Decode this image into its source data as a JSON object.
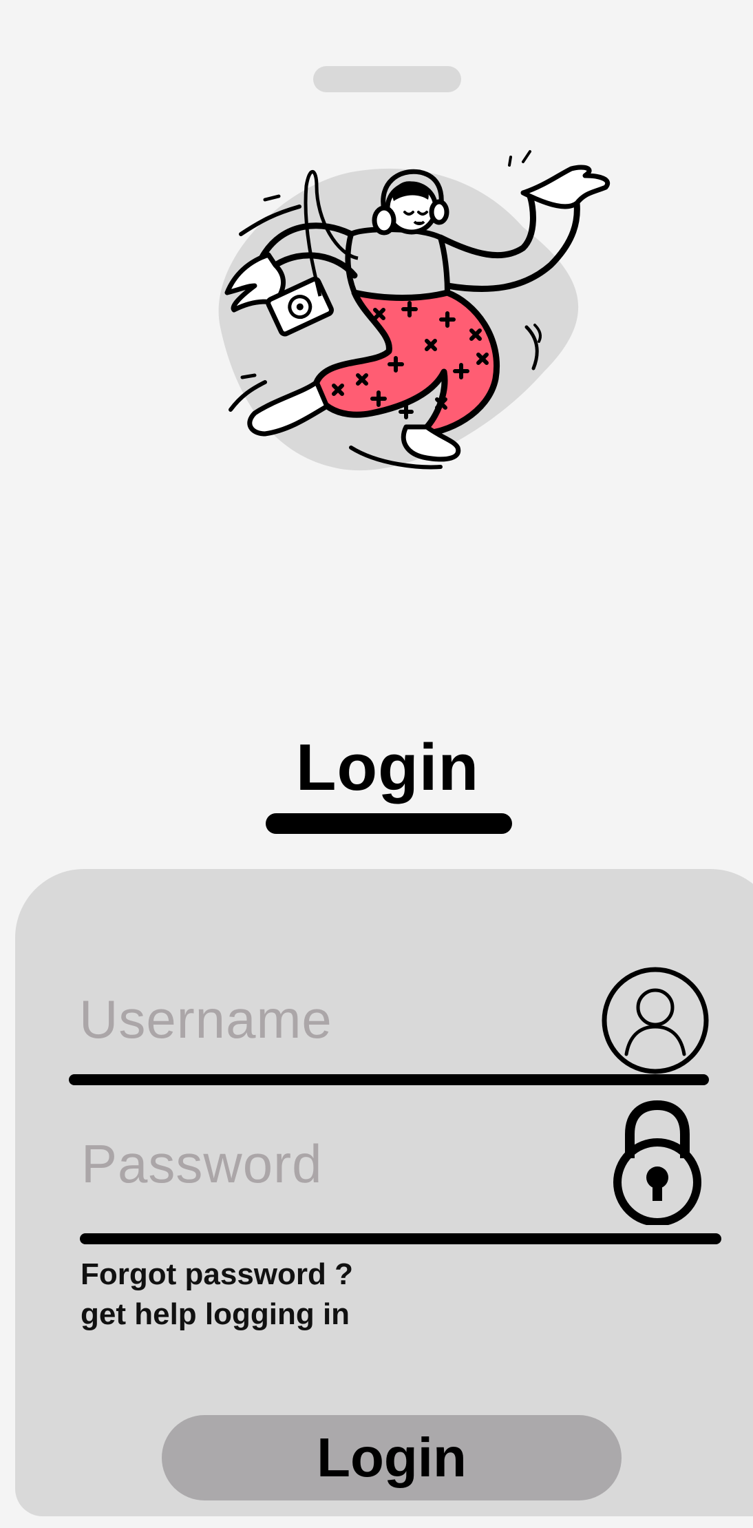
{
  "screen": {
    "heading": "Login"
  },
  "form": {
    "username_placeholder": "Username",
    "password_placeholder": "Password",
    "forgot_line1": "Forgot password ?",
    "forgot_line2": "get help logging in",
    "submit_label": "Login"
  },
  "icons": {
    "username": "user-icon",
    "password": "lock-icon",
    "hero": "dancing-person-illustration"
  },
  "colors": {
    "background": "#f4f4f4",
    "card": "#d9d9d9",
    "placeholder": "#aba6a8",
    "button": "#aba9ab",
    "accent_pink": "#ff5d73"
  }
}
